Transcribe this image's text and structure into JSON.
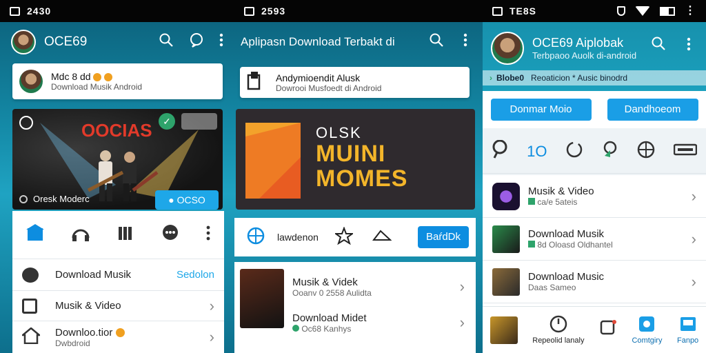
{
  "panel1": {
    "status": {
      "time": "2430"
    },
    "app_title": "OCE69",
    "profile_card": {
      "title": "Mdc 8 dd",
      "subtitle": "Download Musik Android"
    },
    "hero": {
      "poster_title": "OOCIAS",
      "badge_label": "OCSO",
      "caption": "Oresk Moderc"
    },
    "tabs": [
      {
        "icon": "home-icon"
      },
      {
        "icon": "headphones-icon"
      },
      {
        "icon": "library-icon"
      },
      {
        "icon": "chat-icon"
      },
      {
        "icon": "more-vertical-icon"
      }
    ],
    "list": [
      {
        "label": "Download Musik",
        "action": "Sedolon",
        "icon": "bug-icon"
      },
      {
        "label": "Musik & Video",
        "icon": "archive-icon"
      },
      {
        "label": "Downloo.tior",
        "sub": "Dwbdroid",
        "icon": "house-icon"
      }
    ]
  },
  "panel2": {
    "status": {
      "time": "2593"
    },
    "app_title": "Aplipasn Download Terbakt di",
    "info_card": {
      "title": "Andymioendit Alusk",
      "subtitle": "Dowrooi Musfoedt di Android"
    },
    "banner": {
      "line1": "OLSK",
      "line2": "MUINI",
      "line3": "MOMES"
    },
    "action_bar": {
      "item_label": "lawdenon",
      "button_label": "BaŕdDk"
    },
    "list": [
      {
        "title": "Musik & Videk",
        "sub": "Ooanv 0 2558 Aulidta"
      },
      {
        "title": "Download Midet",
        "sub": "Oc68 Kanhys"
      }
    ]
  },
  "panel3": {
    "status": {
      "time": "TE8S"
    },
    "profile": {
      "title": "OCE69 Aiplobak",
      "subtitle": "Terbpaoo Auolk di-android"
    },
    "banner_strip": {
      "tag": "Blobe0",
      "text": "Reoaticion * Ausic binodrd"
    },
    "buttons": [
      "Donmar Moio",
      "Dandhoeom"
    ],
    "quick": [
      {
        "icon": "pin-icon"
      },
      {
        "icon": "count",
        "label": "1O"
      },
      {
        "icon": "refresh-icon"
      },
      {
        "icon": "location-icon"
      },
      {
        "icon": "globe-icon"
      },
      {
        "icon": "keyboard-icon"
      }
    ],
    "list": [
      {
        "title": "Musik & Video",
        "sub": "ca/e 5ateis"
      },
      {
        "title": "Download Musik",
        "sub": "8d Oloasd Oldhantel"
      },
      {
        "title": "Download Music",
        "sub": "Daas Sameo"
      }
    ],
    "bottom_nav": [
      {
        "label": "Repeolid lanaly",
        "icon": "compass-icon"
      },
      {
        "label": "",
        "icon": "notification-icon"
      },
      {
        "label": "Comtgiry",
        "icon": "category-icon"
      },
      {
        "label": "Fanpo",
        "icon": "image-icon"
      }
    ]
  },
  "colors": {
    "accent": "#0d8de0",
    "teal": "#1489a6",
    "bar": "#050505"
  }
}
